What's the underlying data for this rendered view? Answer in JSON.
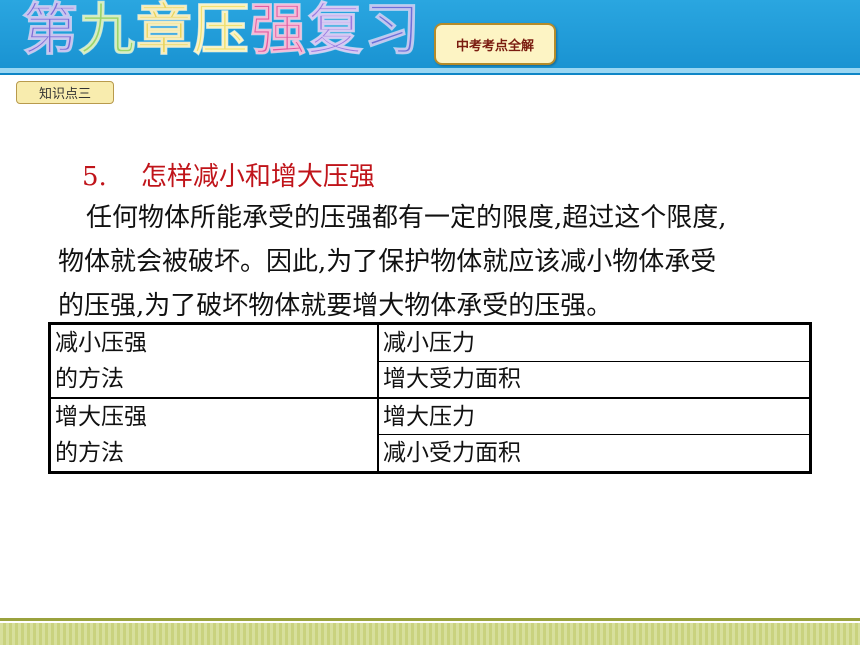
{
  "header": {
    "chapter_title": [
      "第",
      "九",
      "章",
      "压",
      "强",
      "复",
      "习"
    ],
    "badge": "中考考点全解"
  },
  "section_badge": "知识点三",
  "heading": {
    "number": "5.",
    "text": "怎样减小和增大压强"
  },
  "paragraph": [
    "任何物体所能承受的压强都有一定的限度,超过这个限度,",
    "物体就会被破坏。因此,为了保护物体就应该减小物体承受",
    "的压强,为了破坏物体就要增大物体承受的压强。"
  ],
  "table": {
    "groups": [
      {
        "category_line1": "减小压强",
        "category_line2": "的方法",
        "items": [
          "减小压力",
          "增大受力面积"
        ]
      },
      {
        "category_line1": "增大压强",
        "category_line2": "的方法",
        "items": [
          "增大压力",
          "减小受力面积"
        ]
      }
    ]
  },
  "colors": {
    "header_blue": "#1a93d2",
    "heading_red": "#c0141a",
    "badge_fill": "#fdf4c4"
  }
}
